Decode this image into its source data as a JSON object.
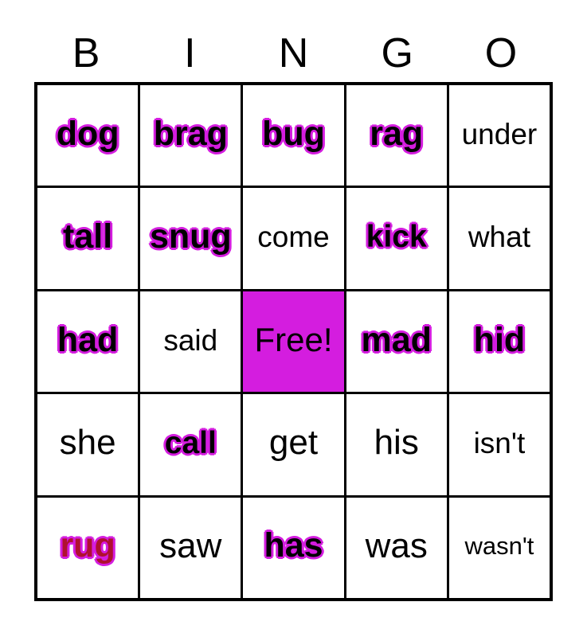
{
  "header": {
    "letters": [
      "B",
      "I",
      "N",
      "G",
      "O"
    ]
  },
  "colors": {
    "marker": "#d41ddf",
    "free_background": "#d41ddf",
    "crimson_word": "#b01030",
    "text": "#000000",
    "cell_background": "#ffffff",
    "grid_line": "#000000"
  },
  "grid": {
    "rows": [
      [
        {
          "text": "dog",
          "style": "marked"
        },
        {
          "text": "brag",
          "style": "marked"
        },
        {
          "text": "bug",
          "style": "marked"
        },
        {
          "text": "rag",
          "style": "marked"
        },
        {
          "text": "under",
          "style": "plain-long"
        }
      ],
      [
        {
          "text": "tall",
          "style": "marked"
        },
        {
          "text": "snug",
          "style": "marked"
        },
        {
          "text": "come",
          "style": "plain-long"
        },
        {
          "text": "kick",
          "style": "marked-narrow"
        },
        {
          "text": "what",
          "style": "plain-long"
        }
      ],
      [
        {
          "text": "had",
          "style": "marked"
        },
        {
          "text": "said",
          "style": "plain-long"
        },
        {
          "text": "Free!",
          "style": "free"
        },
        {
          "text": "mad",
          "style": "marked"
        },
        {
          "text": "hid",
          "style": "marked"
        }
      ],
      [
        {
          "text": "she",
          "style": "plain"
        },
        {
          "text": "call",
          "style": "marked-narrow"
        },
        {
          "text": "get",
          "style": "plain"
        },
        {
          "text": "his",
          "style": "plain"
        },
        {
          "text": "isn't",
          "style": "plain-long"
        }
      ],
      [
        {
          "text": "rug",
          "style": "marked-crimson"
        },
        {
          "text": "saw",
          "style": "plain"
        },
        {
          "text": "has",
          "style": "marked"
        },
        {
          "text": "was",
          "style": "plain"
        },
        {
          "text": "wasn't",
          "style": "plain-xlong"
        }
      ]
    ]
  }
}
